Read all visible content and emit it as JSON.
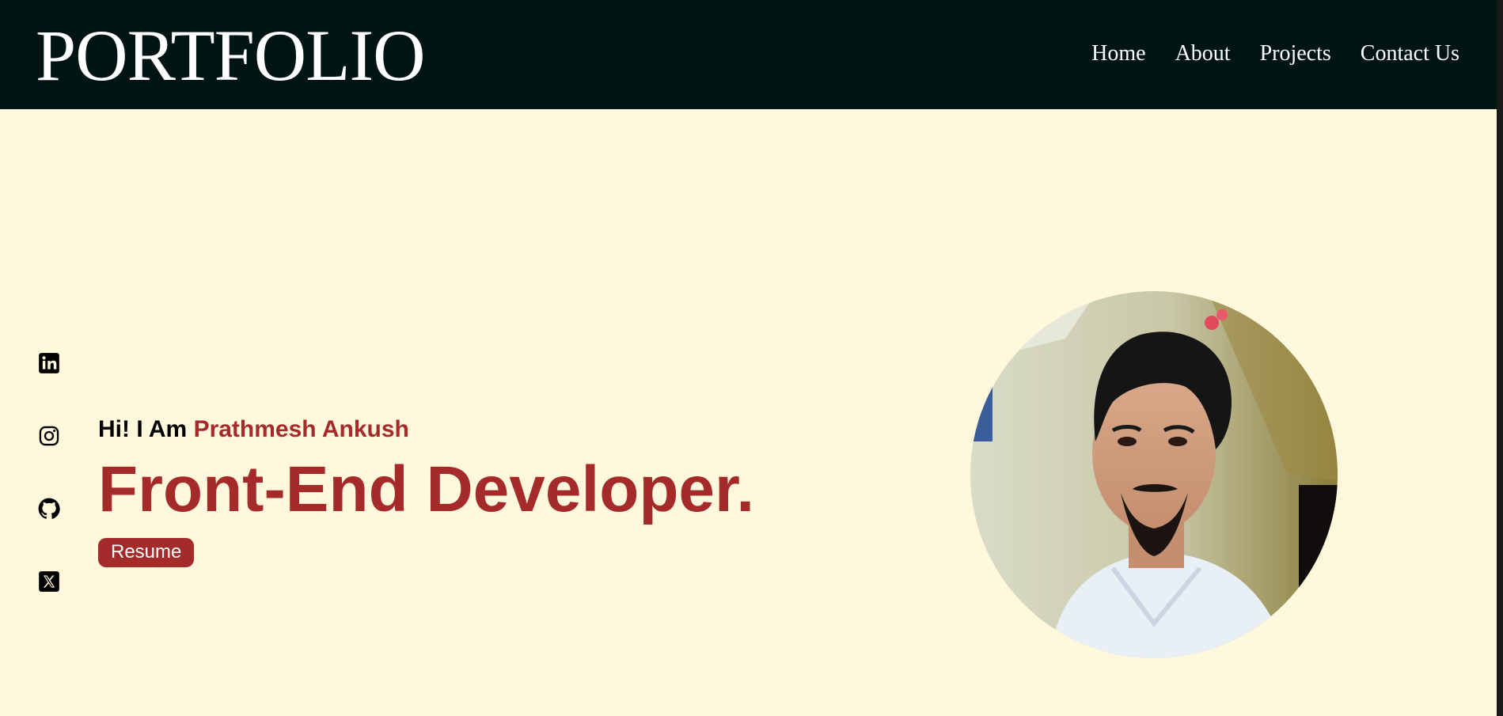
{
  "header": {
    "logo": "PORTFOLIO",
    "nav": [
      {
        "label": "Home"
      },
      {
        "label": "About"
      },
      {
        "label": "Projects"
      },
      {
        "label": "Contact Us"
      }
    ]
  },
  "socials": [
    {
      "icon": "linkedin-icon"
    },
    {
      "icon": "instagram-icon"
    },
    {
      "icon": "github-icon"
    },
    {
      "icon": "x-twitter-icon"
    }
  ],
  "hero": {
    "greeting": "Hi! I Am ",
    "name": "Prathmesh Ankush",
    "role": "Front-End Developer.",
    "resume_label": "Resume",
    "photo_icon": "profile-photo"
  },
  "colors": {
    "header_bg": "#001414",
    "page_bg": "#fff8dc",
    "accent": "#a52a2a",
    "header_text": "#ffffff"
  }
}
